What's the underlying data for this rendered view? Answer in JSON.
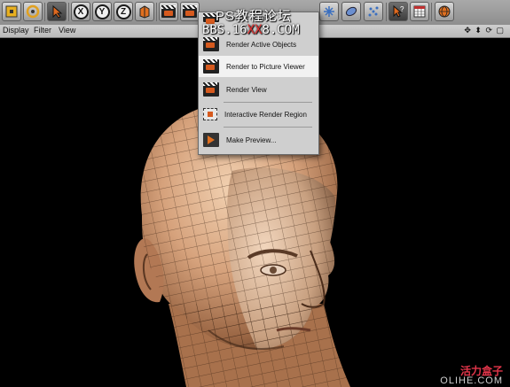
{
  "viewport_menu": {
    "display": "Display",
    "filter": "Filter",
    "view": "View",
    "nav_icons": "✥ ⬍ ⟳ ▢"
  },
  "toolbar": {
    "axis_x": "X",
    "axis_y": "Y",
    "axis_z": "Z"
  },
  "render_menu": {
    "items": [
      {
        "label": "Render Region",
        "icon": "clapper-icon"
      },
      {
        "label": "Render Active Objects",
        "icon": "clapper-icon"
      },
      {
        "label": "Render to Picture Viewer",
        "icon": "clapper-icon",
        "highlighted": true
      },
      {
        "label": "Render View",
        "icon": "clapper-icon"
      },
      {
        "label": "Interactive Render Region",
        "icon": "region-icon"
      },
      {
        "label": "Make Preview...",
        "icon": "preview-icon"
      }
    ]
  },
  "watermarks": {
    "site_cn": "PS教程论坛",
    "bbs_prefix": "BBS.16",
    "bbs_red": "XX",
    "bbs_suffix": "8.COM",
    "corner_cn": "活力盒子",
    "corner_en": "OLIHE.COM"
  },
  "colors": {
    "accent_orange": "#d65a1e",
    "menu_bg": "#cfcfcf",
    "menu_highlight": "#f2f2f2",
    "watermark_red": "#e23030"
  }
}
